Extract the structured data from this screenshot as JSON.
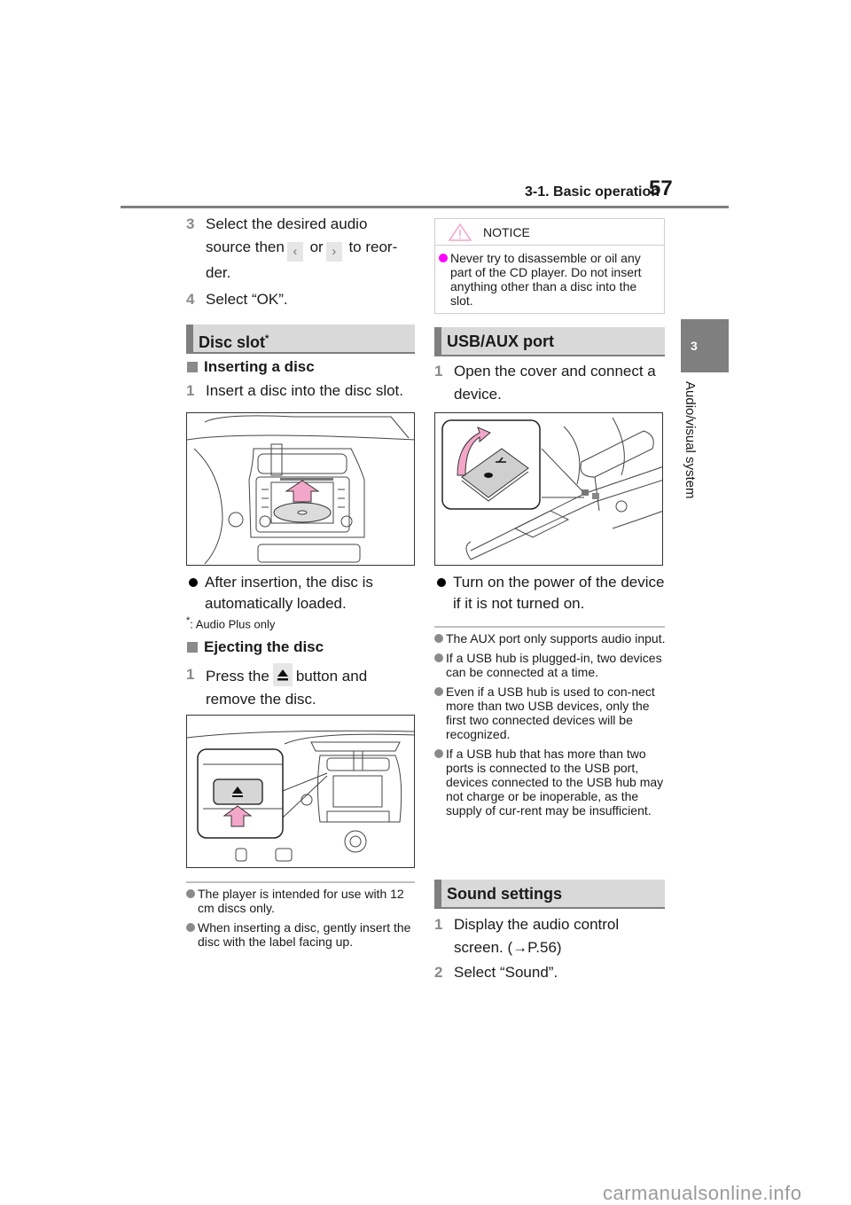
{
  "header": {
    "section_title": "3-1. Basic operation",
    "page_number": "57"
  },
  "side_tab": {
    "chapter_number": "3",
    "chapter_title": "Audio/visual system"
  },
  "left_column": {
    "steps_top": [
      {
        "num": "3",
        "text_a": "Select the desired audio source then",
        "between": "or",
        "text_b": "to reor-der."
      },
      {
        "num": "4",
        "text": "Select “OK”."
      }
    ],
    "prev_icon": "chevron-left-icon",
    "next_icon": "chevron-right-icon",
    "disc_slot": {
      "heading": "Disc slot",
      "heading_mark": "*",
      "inserting": {
        "subheading": "Inserting a disc",
        "step": {
          "num": "1",
          "text": "Insert a disc into the disc slot."
        },
        "figure_label": "disc-slot-illustration",
        "bullet": "After insertion, the disc is automatically loaded."
      },
      "footnote_mark": "*",
      "footnote": ": Audio Plus only",
      "ejecting": {
        "subheading": "Ejecting the disc",
        "step": {
          "num": "1",
          "text_a": "Press the",
          "text_b": "button and remove the disc."
        },
        "button_icon": "eject-icon",
        "figure_label": "eject-button-illustration"
      },
      "notes": [
        "The player is intended for use with 12 cm discs only.",
        "When inserting a disc, gently insert the disc with the label facing up."
      ]
    }
  },
  "right_column": {
    "notice": {
      "title": "NOTICE",
      "items": [
        "Never try to disassemble or oil any part of the CD player. Do not insert anything other than a disc into the slot."
      ]
    },
    "usb_aux": {
      "heading": "USB/AUX port",
      "step": {
        "num": "1",
        "text": "Open the cover and connect a device."
      },
      "figure_label": "usb-aux-port-illustration",
      "bullet": "Turn on the power of the device if it is not turned on.",
      "notes": [
        "The AUX port only supports audio input.",
        "If a USB hub is plugged-in, two devices can be connected at a time.",
        "Even if a USB hub is used to con-nect more than two USB devices, only the first two connected devices will be recognized.",
        "If a USB hub that has more than two ports is connected to the USB port, devices connected to the USB hub may not charge or be inoperable, as the supply of cur-rent may be insufficient."
      ]
    },
    "sound_settings": {
      "heading": "Sound settings",
      "steps": [
        {
          "num": "1",
          "text": "Display the audio control screen. (→P.56)"
        },
        {
          "num": "2",
          "text": "Select “Sound”."
        }
      ]
    }
  },
  "watermark": "carmanualsonline.info",
  "colors": {
    "accent_gray": "#7f7f7f",
    "section_bg": "#d9d9d9",
    "notice_bullet": "#ff00ff",
    "arrow_pink": "#f2a6c8"
  }
}
